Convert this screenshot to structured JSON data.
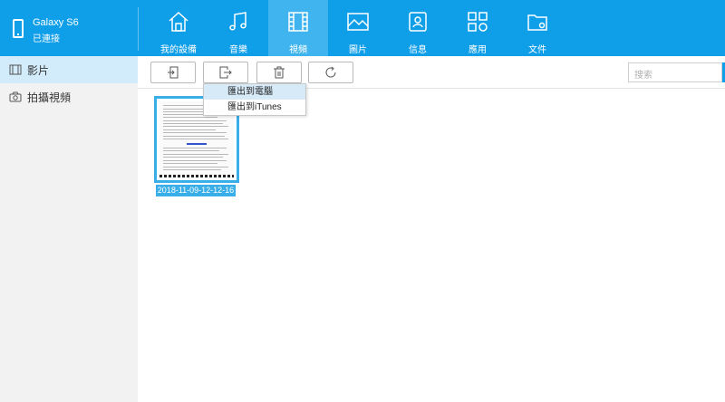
{
  "device": {
    "name": "Galaxy S6",
    "status": "已連接",
    "icon": "phone-icon"
  },
  "nav": [
    {
      "label": "我的設備",
      "icon": "home-icon"
    },
    {
      "label": "音樂",
      "icon": "music-icon"
    },
    {
      "label": "視頻",
      "icon": "film-icon"
    },
    {
      "label": "圖片",
      "icon": "image-icon"
    },
    {
      "label": "信息",
      "icon": "contacts-icon"
    },
    {
      "label": "應用",
      "icon": "apps-icon"
    },
    {
      "label": "文件",
      "icon": "folder-icon"
    }
  ],
  "active_nav": "視頻",
  "sidebar": [
    {
      "label": "影片",
      "icon": "film-strip-icon"
    },
    {
      "label": "拍攝視頻",
      "icon": "camera-icon"
    }
  ],
  "toolbar": {
    "import_icon": "import-icon",
    "export_icon": "export-icon",
    "delete_icon": "trash-icon",
    "refresh_icon": "refresh-icon",
    "search_placeholder": "搜索"
  },
  "export_menu": [
    {
      "label": "匯出到電腦"
    },
    {
      "label": "匯出到iTunes"
    }
  ],
  "videos": [
    {
      "caption": "2018-11-09-12-12-16"
    }
  ],
  "colors": {
    "accent": "#0f9ee8",
    "active_tab": "#3fb4ee",
    "selection": "#39aee8"
  }
}
